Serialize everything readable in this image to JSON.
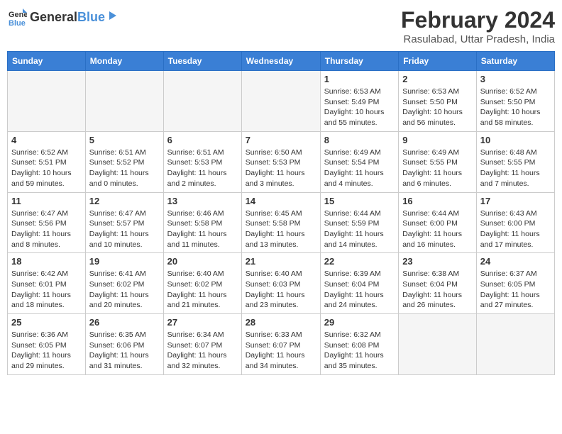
{
  "header": {
    "logo_general": "General",
    "logo_blue": "Blue",
    "month_title": "February 2024",
    "location": "Rasulabad, Uttar Pradesh, India"
  },
  "weekdays": [
    "Sunday",
    "Monday",
    "Tuesday",
    "Wednesday",
    "Thursday",
    "Friday",
    "Saturday"
  ],
  "weeks": [
    [
      {
        "num": "",
        "empty": true
      },
      {
        "num": "",
        "empty": true
      },
      {
        "num": "",
        "empty": true
      },
      {
        "num": "",
        "empty": true
      },
      {
        "num": "1",
        "sunrise": "Sunrise: 6:53 AM",
        "sunset": "Sunset: 5:49 PM",
        "daylight": "Daylight: 10 hours and 55 minutes."
      },
      {
        "num": "2",
        "sunrise": "Sunrise: 6:53 AM",
        "sunset": "Sunset: 5:50 PM",
        "daylight": "Daylight: 10 hours and 56 minutes."
      },
      {
        "num": "3",
        "sunrise": "Sunrise: 6:52 AM",
        "sunset": "Sunset: 5:50 PM",
        "daylight": "Daylight: 10 hours and 58 minutes."
      }
    ],
    [
      {
        "num": "4",
        "sunrise": "Sunrise: 6:52 AM",
        "sunset": "Sunset: 5:51 PM",
        "daylight": "Daylight: 10 hours and 59 minutes."
      },
      {
        "num": "5",
        "sunrise": "Sunrise: 6:51 AM",
        "sunset": "Sunset: 5:52 PM",
        "daylight": "Daylight: 11 hours and 0 minutes."
      },
      {
        "num": "6",
        "sunrise": "Sunrise: 6:51 AM",
        "sunset": "Sunset: 5:53 PM",
        "daylight": "Daylight: 11 hours and 2 minutes."
      },
      {
        "num": "7",
        "sunrise": "Sunrise: 6:50 AM",
        "sunset": "Sunset: 5:53 PM",
        "daylight": "Daylight: 11 hours and 3 minutes."
      },
      {
        "num": "8",
        "sunrise": "Sunrise: 6:49 AM",
        "sunset": "Sunset: 5:54 PM",
        "daylight": "Daylight: 11 hours and 4 minutes."
      },
      {
        "num": "9",
        "sunrise": "Sunrise: 6:49 AM",
        "sunset": "Sunset: 5:55 PM",
        "daylight": "Daylight: 11 hours and 6 minutes."
      },
      {
        "num": "10",
        "sunrise": "Sunrise: 6:48 AM",
        "sunset": "Sunset: 5:55 PM",
        "daylight": "Daylight: 11 hours and 7 minutes."
      }
    ],
    [
      {
        "num": "11",
        "sunrise": "Sunrise: 6:47 AM",
        "sunset": "Sunset: 5:56 PM",
        "daylight": "Daylight: 11 hours and 8 minutes."
      },
      {
        "num": "12",
        "sunrise": "Sunrise: 6:47 AM",
        "sunset": "Sunset: 5:57 PM",
        "daylight": "Daylight: 11 hours and 10 minutes."
      },
      {
        "num": "13",
        "sunrise": "Sunrise: 6:46 AM",
        "sunset": "Sunset: 5:58 PM",
        "daylight": "Daylight: 11 hours and 11 minutes."
      },
      {
        "num": "14",
        "sunrise": "Sunrise: 6:45 AM",
        "sunset": "Sunset: 5:58 PM",
        "daylight": "Daylight: 11 hours and 13 minutes."
      },
      {
        "num": "15",
        "sunrise": "Sunrise: 6:44 AM",
        "sunset": "Sunset: 5:59 PM",
        "daylight": "Daylight: 11 hours and 14 minutes."
      },
      {
        "num": "16",
        "sunrise": "Sunrise: 6:44 AM",
        "sunset": "Sunset: 6:00 PM",
        "daylight": "Daylight: 11 hours and 16 minutes."
      },
      {
        "num": "17",
        "sunrise": "Sunrise: 6:43 AM",
        "sunset": "Sunset: 6:00 PM",
        "daylight": "Daylight: 11 hours and 17 minutes."
      }
    ],
    [
      {
        "num": "18",
        "sunrise": "Sunrise: 6:42 AM",
        "sunset": "Sunset: 6:01 PM",
        "daylight": "Daylight: 11 hours and 18 minutes."
      },
      {
        "num": "19",
        "sunrise": "Sunrise: 6:41 AM",
        "sunset": "Sunset: 6:02 PM",
        "daylight": "Daylight: 11 hours and 20 minutes."
      },
      {
        "num": "20",
        "sunrise": "Sunrise: 6:40 AM",
        "sunset": "Sunset: 6:02 PM",
        "daylight": "Daylight: 11 hours and 21 minutes."
      },
      {
        "num": "21",
        "sunrise": "Sunrise: 6:40 AM",
        "sunset": "Sunset: 6:03 PM",
        "daylight": "Daylight: 11 hours and 23 minutes."
      },
      {
        "num": "22",
        "sunrise": "Sunrise: 6:39 AM",
        "sunset": "Sunset: 6:04 PM",
        "daylight": "Daylight: 11 hours and 24 minutes."
      },
      {
        "num": "23",
        "sunrise": "Sunrise: 6:38 AM",
        "sunset": "Sunset: 6:04 PM",
        "daylight": "Daylight: 11 hours and 26 minutes."
      },
      {
        "num": "24",
        "sunrise": "Sunrise: 6:37 AM",
        "sunset": "Sunset: 6:05 PM",
        "daylight": "Daylight: 11 hours and 27 minutes."
      }
    ],
    [
      {
        "num": "25",
        "sunrise": "Sunrise: 6:36 AM",
        "sunset": "Sunset: 6:05 PM",
        "daylight": "Daylight: 11 hours and 29 minutes."
      },
      {
        "num": "26",
        "sunrise": "Sunrise: 6:35 AM",
        "sunset": "Sunset: 6:06 PM",
        "daylight": "Daylight: 11 hours and 31 minutes."
      },
      {
        "num": "27",
        "sunrise": "Sunrise: 6:34 AM",
        "sunset": "Sunset: 6:07 PM",
        "daylight": "Daylight: 11 hours and 32 minutes."
      },
      {
        "num": "28",
        "sunrise": "Sunrise: 6:33 AM",
        "sunset": "Sunset: 6:07 PM",
        "daylight": "Daylight: 11 hours and 34 minutes."
      },
      {
        "num": "29",
        "sunrise": "Sunrise: 6:32 AM",
        "sunset": "Sunset: 6:08 PM",
        "daylight": "Daylight: 11 hours and 35 minutes."
      },
      {
        "num": "",
        "empty": true
      },
      {
        "num": "",
        "empty": true
      }
    ]
  ]
}
